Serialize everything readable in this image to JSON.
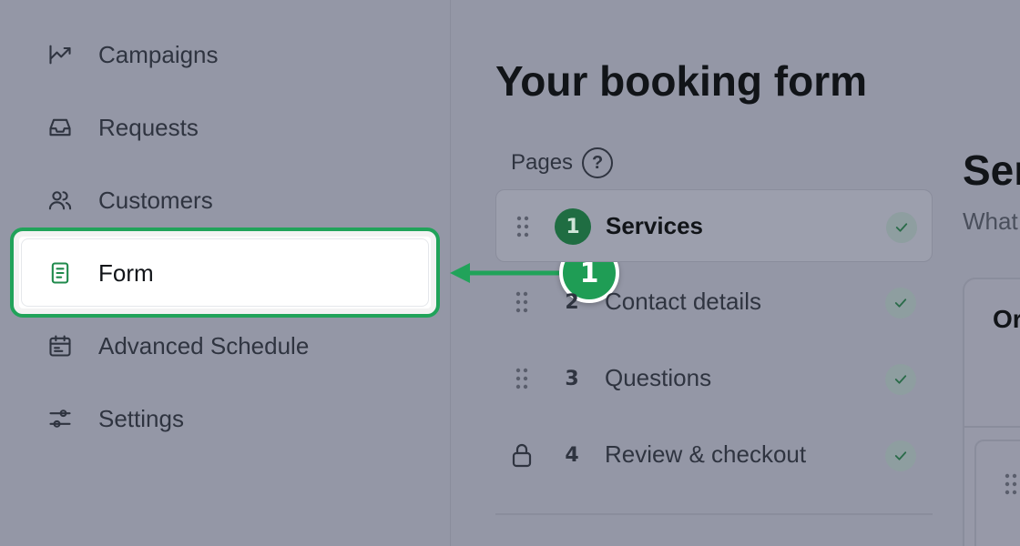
{
  "sidebar": {
    "items": [
      {
        "label": "Campaigns",
        "icon": "trend-chart-icon"
      },
      {
        "label": "Requests",
        "icon": "inbox-icon"
      },
      {
        "label": "Customers",
        "icon": "users-icon"
      },
      {
        "label": "Form",
        "icon": "form-document-icon",
        "active": true
      },
      {
        "label": "Advanced Schedule",
        "icon": "calendar-icon"
      },
      {
        "label": "Settings",
        "icon": "sliders-icon"
      }
    ]
  },
  "callout": {
    "number": "1",
    "color": "#1f9d55"
  },
  "main": {
    "title": "Your booking form",
    "pages_label": "Pages",
    "help_glyph": "?",
    "pages": [
      {
        "number": "1",
        "label": "Services",
        "active": true,
        "icon": "drag-handle-icon"
      },
      {
        "number": "2",
        "label": "Contact details",
        "icon": "drag-handle-icon"
      },
      {
        "number": "3",
        "label": "Questions",
        "icon": "drag-handle-icon"
      },
      {
        "number": "4",
        "label": "Review & checkout",
        "icon": "lock-icon"
      }
    ]
  },
  "right_panel": {
    "title": "Ser",
    "subtitle": "What",
    "card_title": "Or"
  },
  "colors": {
    "accent": "#21a35a",
    "overlay_background": "#9497a6"
  }
}
